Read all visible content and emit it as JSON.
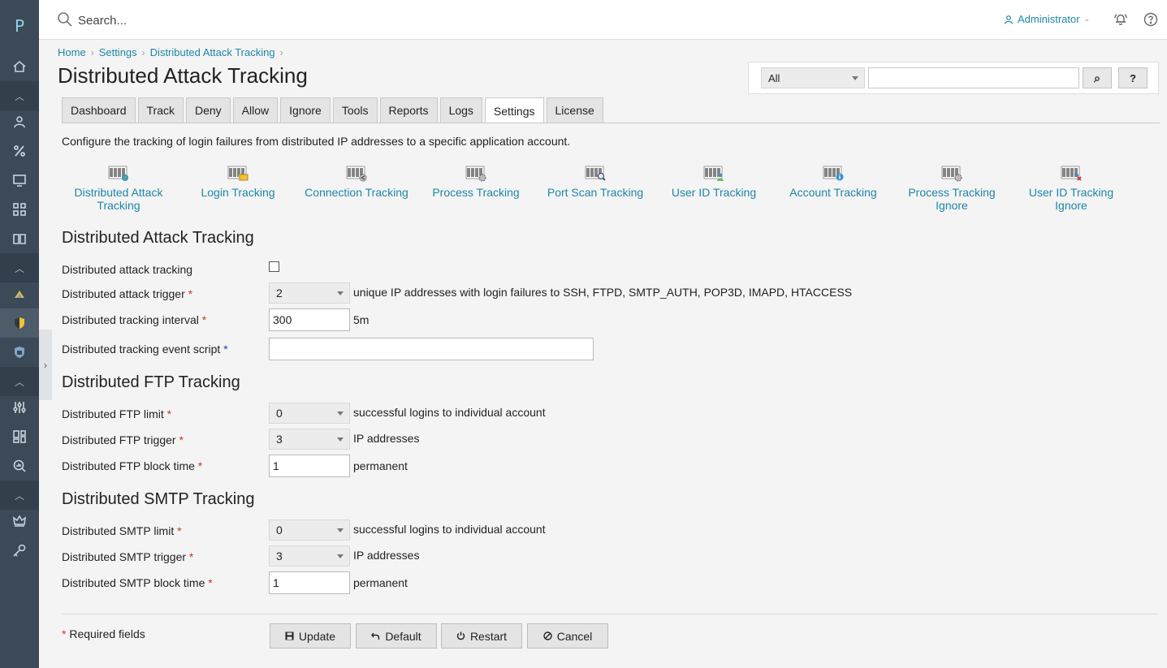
{
  "app": {
    "logo_letter": "P"
  },
  "nav": {
    "items": [
      {
        "icon": "home-icon"
      },
      {
        "icon": "chevron-up-icon"
      },
      {
        "icon": "user-icon"
      },
      {
        "icon": "percent-icon"
      },
      {
        "icon": "monitor-icon"
      },
      {
        "icon": "apps-grid-icon"
      },
      {
        "icon": "book-icon"
      },
      {
        "icon": "chevron-up-icon"
      },
      {
        "icon": "extension-icon"
      },
      {
        "icon": "shield-active-icon"
      },
      {
        "icon": "shield-icon"
      },
      {
        "icon": "chevron-up-icon"
      },
      {
        "icon": "sliders-icon"
      },
      {
        "icon": "dashboard-icon"
      },
      {
        "icon": "search-analytics-icon"
      },
      {
        "icon": "chevron-up-icon"
      },
      {
        "icon": "crown-icon"
      },
      {
        "icon": "key-icon"
      }
    ]
  },
  "topbar": {
    "search_placeholder": "Search...",
    "user_label": "Administrator"
  },
  "breadcrumb": [
    "Home",
    "Settings",
    "Distributed Attack Tracking"
  ],
  "page_title": "Distributed Attack Tracking",
  "panel": {
    "scope_value": "All",
    "go_label": "⌕",
    "help_label": "?"
  },
  "tabs": [
    "Dashboard",
    "Track",
    "Deny",
    "Allow",
    "Ignore",
    "Tools",
    "Reports",
    "Logs",
    "Settings",
    "License"
  ],
  "active_tab": "Settings",
  "description": "Configure the tracking of login failures from distributed IP addresses to a specific application account.",
  "tools": [
    {
      "line1": "Distributed Attack",
      "line2": "Tracking",
      "icon": "distributed-attack-icon"
    },
    {
      "line1": "Login Tracking",
      "line2": "",
      "icon": "login-tracking-icon"
    },
    {
      "line1": "Connection Tracking",
      "line2": "",
      "icon": "connection-tracking-icon"
    },
    {
      "line1": "Process Tracking",
      "line2": "",
      "icon": "process-tracking-icon"
    },
    {
      "line1": "Port Scan Tracking",
      "line2": "",
      "icon": "port-scan-icon"
    },
    {
      "line1": "User ID Tracking",
      "line2": "",
      "icon": "user-id-tracking-icon"
    },
    {
      "line1": "Account Tracking",
      "line2": "",
      "icon": "account-tracking-icon"
    },
    {
      "line1": "Process Tracking",
      "line2": "Ignore",
      "icon": "process-ignore-icon"
    },
    {
      "line1": "User ID Tracking",
      "line2": "Ignore",
      "icon": "user-id-ignore-icon"
    }
  ],
  "sections": {
    "attack": {
      "title": "Distributed Attack Tracking",
      "tracking_label": "Distributed attack tracking",
      "tracking_checked": false,
      "trigger_label": "Distributed attack trigger",
      "trigger_value": "2",
      "trigger_suffix": "unique IP addresses with login failures to SSH, FTPD, SMTP_AUTH, POP3D, IMAPD, HTACCESS",
      "interval_label": "Distributed tracking interval",
      "interval_value": "300",
      "interval_suffix": "5m",
      "script_label": "Distributed tracking event script",
      "script_value": ""
    },
    "ftp": {
      "title": "Distributed FTP Tracking",
      "limit_label": "Distributed FTP limit",
      "limit_value": "0",
      "limit_suffix": "successful logins to individual account",
      "trigger_label": "Distributed FTP trigger",
      "trigger_value": "3",
      "trigger_suffix": "IP addresses",
      "block_label": "Distributed FTP block time",
      "block_value": "1",
      "block_suffix": "permanent"
    },
    "smtp": {
      "title": "Distributed SMTP Tracking",
      "limit_label": "Distributed SMTP limit",
      "limit_value": "0",
      "limit_suffix": "successful logins to individual account",
      "trigger_label": "Distributed SMTP trigger",
      "trigger_value": "3",
      "trigger_suffix": "IP addresses",
      "block_label": "Distributed SMTP block time",
      "block_value": "1",
      "block_suffix": "permanent"
    }
  },
  "required_marker": "*",
  "required_note": "Required fields",
  "buttons": {
    "update": "Update",
    "default": "Default",
    "restart": "Restart",
    "cancel": "Cancel"
  },
  "colors": {
    "accent": "#1d87a8",
    "rail": "#3c4956",
    "required": "#c0392b"
  }
}
